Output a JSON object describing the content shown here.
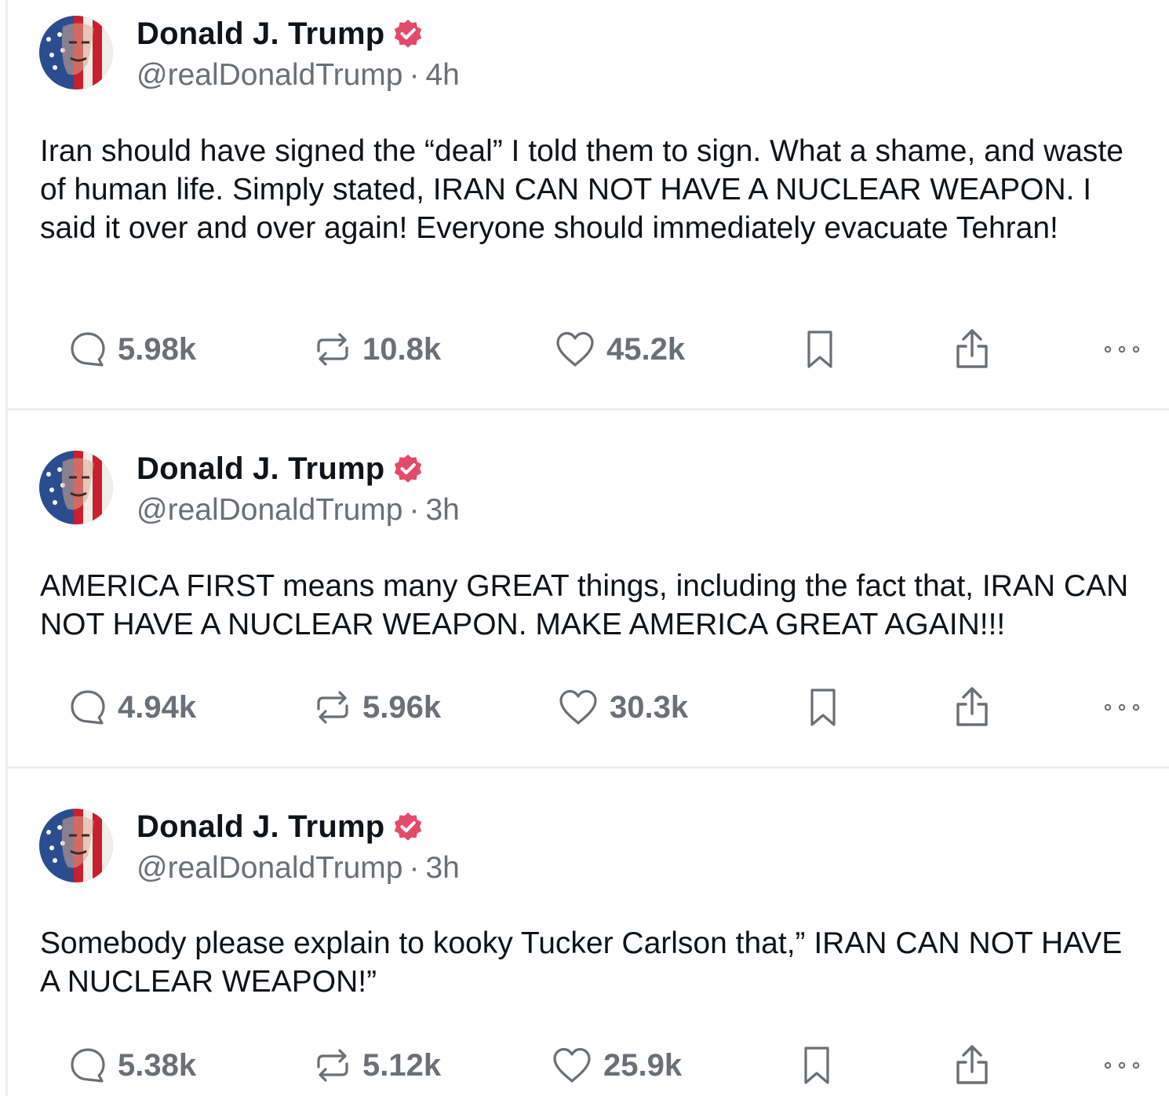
{
  "author": {
    "name": "Donald J. Trump",
    "handle": "@realDonaldTrump"
  },
  "colors": {
    "verified_badge": "#e34b6b",
    "text_primary": "#0f1419",
    "text_secondary": "#6b6f76",
    "divider": "#e9ebee"
  },
  "icons": {
    "reply": "speech-bubble-icon",
    "repost": "repost-arrows-icon",
    "like": "heart-icon",
    "bookmark": "bookmark-icon",
    "share": "share-upload-icon",
    "more": "ellipsis-icon",
    "verified": "verified-badge-icon"
  },
  "posts": [
    {
      "name": "Donald J. Trump",
      "handle": "@realDonaldTrump",
      "separator": "·",
      "time": "4h",
      "text": "Iran should have signed the “deal” I told them to sign. What a shame, and waste of human life. Simply stated, IRAN CAN NOT HAVE A NUCLEAR WEAPON. I said it over and over again! Everyone should immediately evacuate Tehran!",
      "replies": "5.98k",
      "reposts": "10.8k",
      "likes": "45.2k"
    },
    {
      "name": "Donald J. Trump",
      "handle": "@realDonaldTrump",
      "separator": "·",
      "time": "3h",
      "text": "AMERICA FIRST means many GREAT things, including the fact that, IRAN CAN NOT HAVE A NUCLEAR WEAPON. MAKE AMERICA GREAT AGAIN!!!",
      "replies": "4.94k",
      "reposts": "5.96k",
      "likes": "30.3k"
    },
    {
      "name": "Donald J. Trump",
      "handle": "@realDonaldTrump",
      "separator": "·",
      "time": "3h",
      "text": "Somebody please explain to kooky Tucker Carlson that,” IRAN CAN NOT HAVE A NUCLEAR WEAPON!”",
      "replies": "5.38k",
      "reposts": "5.12k",
      "likes": "25.9k"
    }
  ]
}
